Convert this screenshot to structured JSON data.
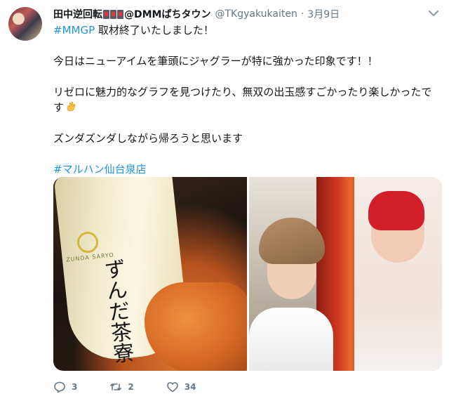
{
  "tweet": {
    "display_name": "田中逆回転",
    "display_name_suffix": "@DMMぱちタウン",
    "handle": "@TKgyakukaiten",
    "separator": "·",
    "date": "3月9日",
    "hashtag_mmgp": "#MMGP",
    "line1_rest": " 取材終了いたしました！",
    "line2": "今日はニューアイムを筆頭にジャグラーが特に強かった印象です！！",
    "line3a": "リゼロに魅力的なグラフを見つけたり、無双の出玉感すごかったり楽しかったで",
    "line3b": "す",
    "line4": "ズンダズンダしながら帰ろうと思います",
    "hashtag_store": "#マルハン仙台泉店"
  },
  "media": {
    "cup_brand": "ZUNDA SARYO",
    "cup_kanji": "ずんだ茶寮"
  },
  "actions": {
    "reply_count": "3",
    "retweet_count": "2",
    "like_count": "34"
  },
  "icons": {
    "reply": "reply-icon",
    "retweet": "retweet-icon",
    "like": "heart-icon",
    "caret": "chevron-down-icon",
    "wave": "waving-hand-icon",
    "slot": "slot-machine-icon"
  },
  "colors": {
    "link": "#1b95e0",
    "secondary_text": "#657786",
    "text": "#14171a"
  }
}
